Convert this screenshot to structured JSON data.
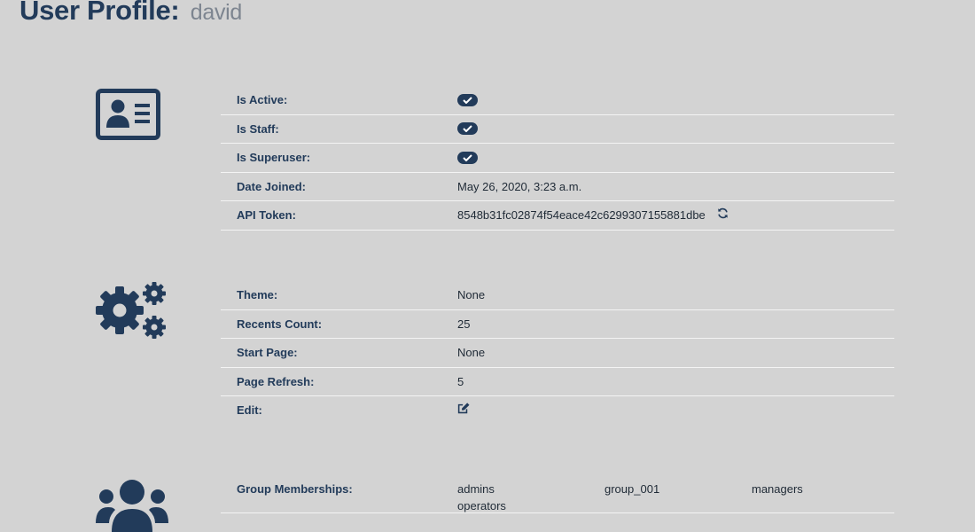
{
  "header": {
    "title": "User Profile:",
    "username": "david"
  },
  "account": {
    "icon": "id-card-icon",
    "rows": [
      {
        "label": "Is Active:",
        "type": "check"
      },
      {
        "label": "Is Staff:",
        "type": "check"
      },
      {
        "label": "Is Superuser:",
        "type": "check"
      },
      {
        "label": "Date Joined:",
        "value": "May 26, 2020, 3:23 a.m."
      },
      {
        "label": "API Token:",
        "value": "8548b31fc02874f54eace42c6299307155881dbe",
        "action_icon": "refresh-icon"
      }
    ]
  },
  "preferences": {
    "icon": "gears-icon",
    "rows": [
      {
        "label": "Theme:",
        "value": "None"
      },
      {
        "label": "Recents Count:",
        "value": "25"
      },
      {
        "label": "Start Page:",
        "value": "None"
      },
      {
        "label": "Page Refresh:",
        "value": "5"
      },
      {
        "label": "Edit:",
        "action_icon": "edit-icon"
      }
    ]
  },
  "groups": {
    "icon": "users-icon",
    "label": "Group Memberships:",
    "items": [
      "admins",
      "group_001",
      "managers",
      "operators"
    ]
  },
  "colors": {
    "background": "#d3d3d3",
    "accent": "#223b5a",
    "muted": "#7d8590",
    "divider": "#f4f4f4"
  }
}
